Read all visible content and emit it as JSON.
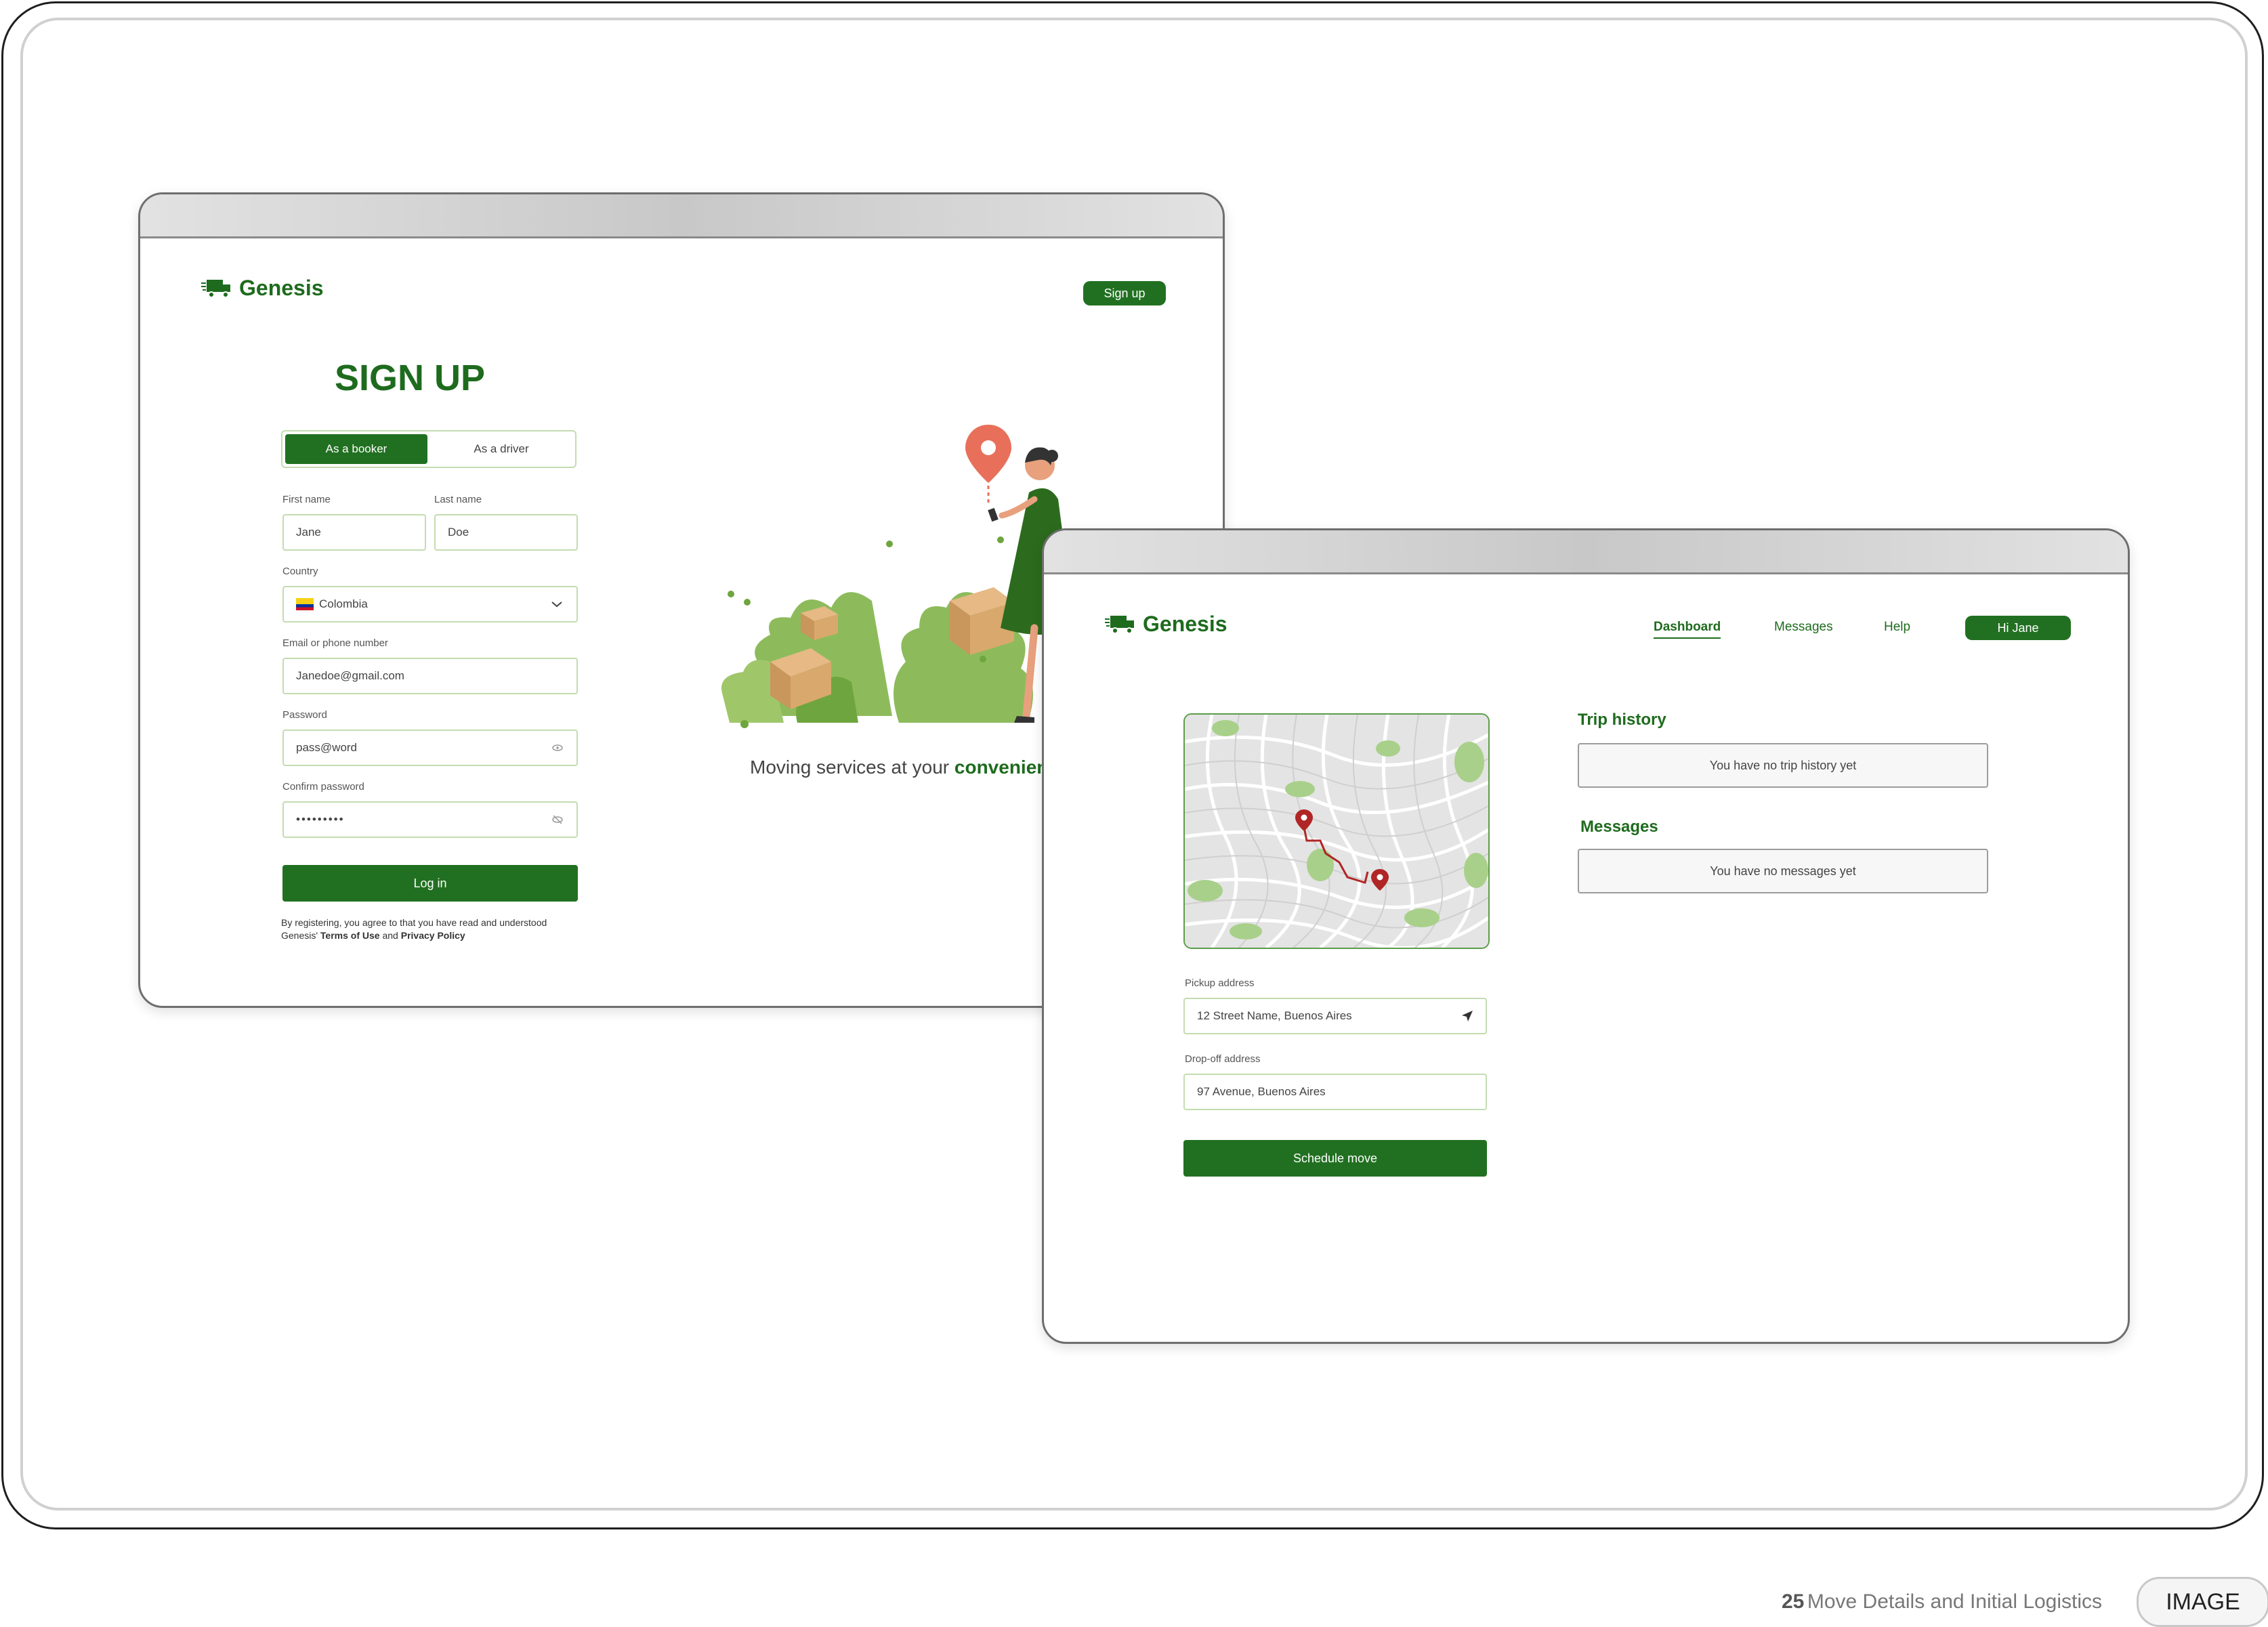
{
  "signup_window": {
    "logo": "Genesis",
    "header_button": "Sign up",
    "title": "SIGN UP",
    "tabs": [
      "As a booker",
      "As a driver"
    ],
    "first_name": {
      "label": "First name",
      "value": "Jane"
    },
    "last_name": {
      "label": "Last name",
      "value": "Doe"
    },
    "country": {
      "label": "Country",
      "value": "Colombia"
    },
    "email": {
      "label": "Email or phone number",
      "value": "Janedoe@gmail.com"
    },
    "password": {
      "label": "Password",
      "value": "pass@word"
    },
    "confirm_password": {
      "label": "Confirm password",
      "value": "•••••••••"
    },
    "submit": "Log in",
    "legal_line1": "By registering, you agree to that you have read and understood",
    "legal_prefix": "Genesis'",
    "terms": "Terms of Use",
    "and": "and",
    "privacy": "Privacy Policy",
    "tagline_prefix": "Moving services at your",
    "tagline_highlight": "convenience"
  },
  "dashboard_window": {
    "logo": "Genesis",
    "nav": [
      "Dashboard",
      "Messages",
      "Help"
    ],
    "user_button": "Hi Jane",
    "trip_history_title": "Trip history",
    "trip_history_empty": "You have no trip history yet",
    "messages_title": "Messages",
    "messages_empty": "You have no messages yet",
    "pickup": {
      "label": "Pickup address",
      "value": "12 Street Name, Buenos Aires"
    },
    "dropoff": {
      "label": "Drop-off address",
      "value": "97 Avenue, Buenos Aires"
    },
    "schedule": "Schedule move"
  },
  "footer": {
    "page_number": "25",
    "section": "Move Details and Initial Logistics",
    "tag": "IMAGE"
  },
  "colors": {
    "brand_green": "#217021",
    "pin_red": "#c0392b",
    "accent_orange": "#e8705a"
  }
}
